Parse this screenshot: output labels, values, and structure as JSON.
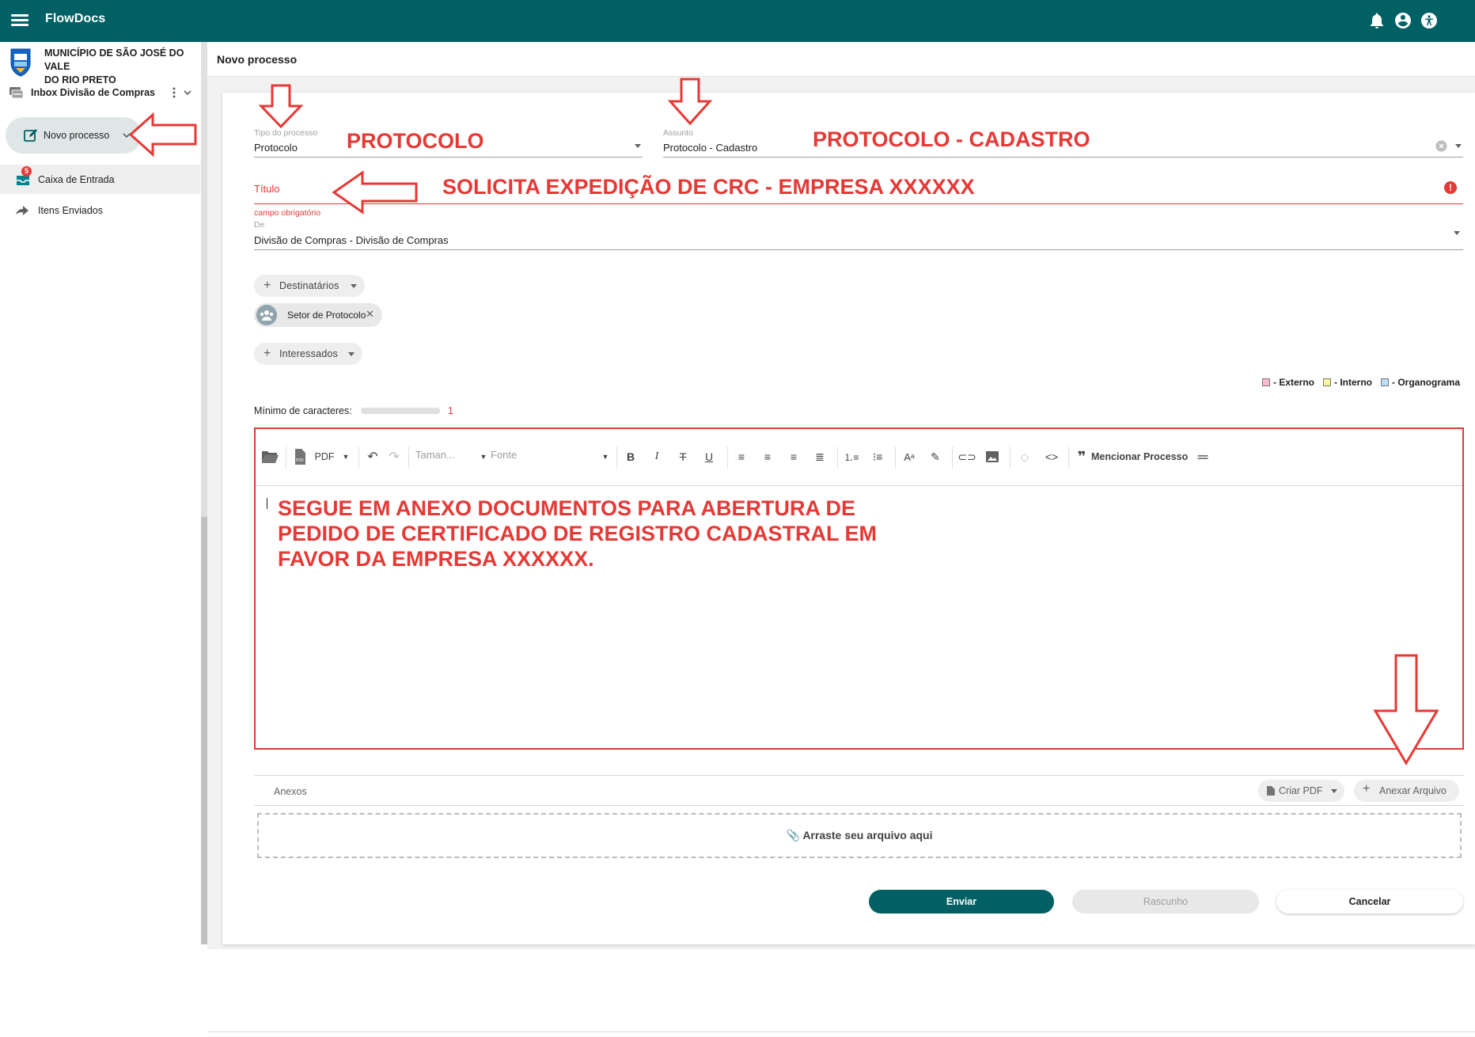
{
  "app": {
    "brand": "FlowDocs"
  },
  "topbar_icons": [
    "bell-icon",
    "account-circle-icon",
    "accessibility-icon"
  ],
  "sidebar": {
    "org_name_line1": "MUNICÍPIO DE SÃO JOSÉ DO VALE",
    "org_name_line2": "DO RIO PRETO",
    "inbox_label": "Inbox Divisão de Compras",
    "new_process_label": "Novo processo",
    "items": [
      {
        "label": "Caixa de Entrada",
        "badge": "5",
        "icon": "inbox-icon"
      },
      {
        "label": "Itens Enviados",
        "icon": "reply-icon"
      }
    ]
  },
  "page": {
    "title": "Novo processo"
  },
  "form": {
    "tipo": {
      "label": "Tipo do processo",
      "value": "Protocolo"
    },
    "assunto": {
      "label": "Assunto",
      "value": "Protocolo - Cadastro"
    },
    "titulo": {
      "label": "Título",
      "error": "campo obrigatório"
    },
    "de": {
      "label": "De",
      "value": "Divisão de Compras  - Divisão de Compras"
    },
    "destinatarios_label": "Destinatários",
    "recipient": "Setor de Protocolo",
    "interessados_label": "Interessados",
    "legend": [
      {
        "label": "- Externo",
        "color": "#f8bbd0"
      },
      {
        "label": "- Interno",
        "color": "#fff59d"
      },
      {
        "label": "- Organograma",
        "color": "#bbdefb"
      }
    ],
    "min_chars_label": "Mínimo de caracteres:",
    "min_chars_value": "1",
    "min_chars_fill": 0
  },
  "toolbar": {
    "pdf_label": "PDF",
    "size_placeholder": "Taman...",
    "font_placeholder": "Fonte",
    "mention_label": "Mencionar Processo"
  },
  "attachments": {
    "label": "Anexos",
    "create_pdf": "Criar PDF",
    "attach_file": "Anexar Arquivo",
    "drop_label": "Arraste seu arquivo aqui"
  },
  "actions": {
    "send": "Enviar",
    "draft": "Rascunho",
    "cancel": "Cancelar"
  },
  "annotations": {
    "protocolo": "PROTOCOLO",
    "protocolo_cadastro": "PROTOCOLO - CADASTRO",
    "titulo_text": "SOLICITA EXPEDIÇÃO DE CRC - EMPRESA XXXXXX",
    "body_line1": "SEGUE EM ANEXO DOCUMENTOS PARA ABERTURA DE",
    "body_line2": "PEDIDO DE CERTIFICADO DE REGISTRO CADASTRAL EM",
    "body_line3": "FAVOR DA EMPRESA XXXXXX."
  }
}
